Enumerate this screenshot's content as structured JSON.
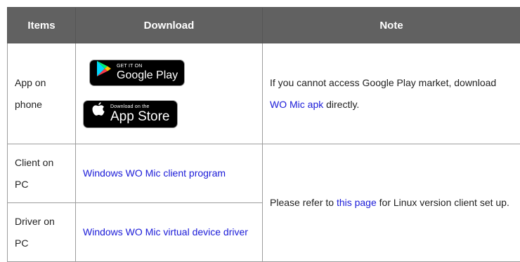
{
  "table": {
    "headers": {
      "items": "Items",
      "download": "Download",
      "note": "Note"
    },
    "rows": {
      "app": {
        "item": "App on phone",
        "google_play": {
          "small": "GET IT ON",
          "big": "Google Play"
        },
        "app_store": {
          "small": "Download on the",
          "big": "App Store"
        },
        "note_pre": "If you cannot access Google Play market, download ",
        "note_link": "WO Mic apk",
        "note_post": " directly."
      },
      "client": {
        "item": "Client on PC",
        "download_link": "Windows WO Mic client program"
      },
      "driver": {
        "item": "Driver on PC",
        "download_link": "Windows WO Mic virtual device driver"
      },
      "linux_note": {
        "pre": "Please refer to ",
        "link": "this page",
        "post": " for Linux version client set up."
      }
    }
  },
  "colors": {
    "header_bg": "#616161",
    "link": "#1a1ad8",
    "border": "#9c9c9c"
  },
  "icons": [
    "google-play-icon",
    "apple-icon"
  ]
}
